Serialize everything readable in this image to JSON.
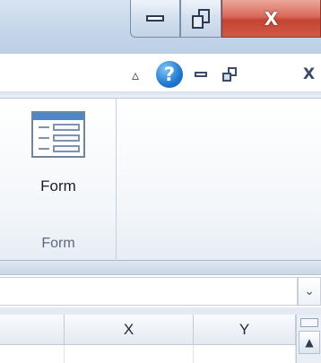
{
  "window": {
    "min_icon": "minimize-icon",
    "max_icon": "maximize-icon",
    "close_glyph": "X"
  },
  "ribbon_controls": {
    "caret_glyph": "▵",
    "help_glyph": "?",
    "close_glyph": "X"
  },
  "ribbon": {
    "form_button_label": "Form",
    "group_label": "Form"
  },
  "formula_bar": {
    "expand_glyph": "⌄"
  },
  "grid": {
    "columns": [
      "",
      "X",
      "Y"
    ],
    "scroll_up_glyph": "▲"
  },
  "colors": {
    "close_button_red": "#c44431",
    "help_blue": "#1d78cf",
    "form_icon_bar": "#4d86c9"
  }
}
